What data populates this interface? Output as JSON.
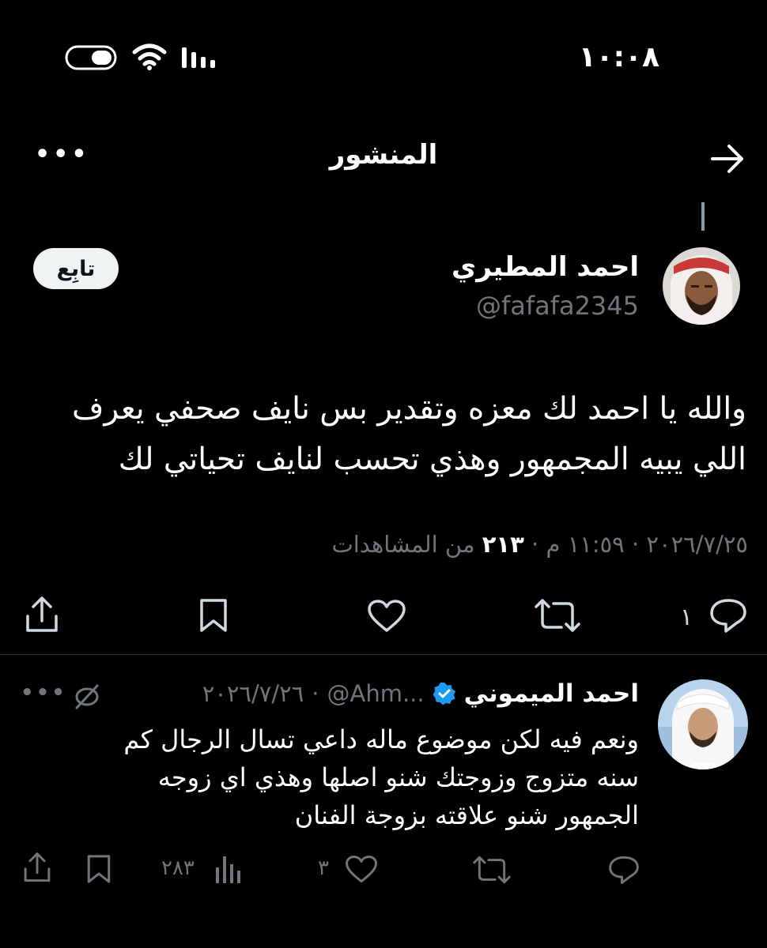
{
  "status_bar": {
    "time": "١٠:٠٨"
  },
  "header": {
    "title": "المنشور"
  },
  "post": {
    "author_name": "احمد المطيري",
    "author_handle": "@fafafa2345",
    "follow_label": "تابِع",
    "text_line1": "والله يا احمد لك معزه وتقدير بس نايف صحفي يعرف",
    "text_line2": "اللي يبيه المجمهور  وهذي تحسب لنايف  تحياتي لك",
    "date": "٢٠٢٦/٧/٢٥",
    "time": "١١:٥٩ م",
    "views_count": "٢١٣",
    "views_label": "من المشاهدات",
    "replies_count": "١"
  },
  "reply": {
    "author_name": "احمد الميموني",
    "author_handle": "@Ahm...",
    "date": "٢٠٢٦/٧/٢٦",
    "text_line1": "ونعم فيه لكن موضوع ماله داعي تسال الرجال كم",
    "text_line2": "سنه متزوج وزوجتك شنو اصلها وهذي اي زوجه",
    "text_line3": "الجمهور شنو علاقته بزوجة الفنان",
    "likes_count": "٣",
    "views_count": "٢٨٣"
  },
  "colors": {
    "background": "#000000",
    "verified": "#1d9bf0",
    "muted": "#71767b",
    "follow_bg": "#eff3f4"
  }
}
